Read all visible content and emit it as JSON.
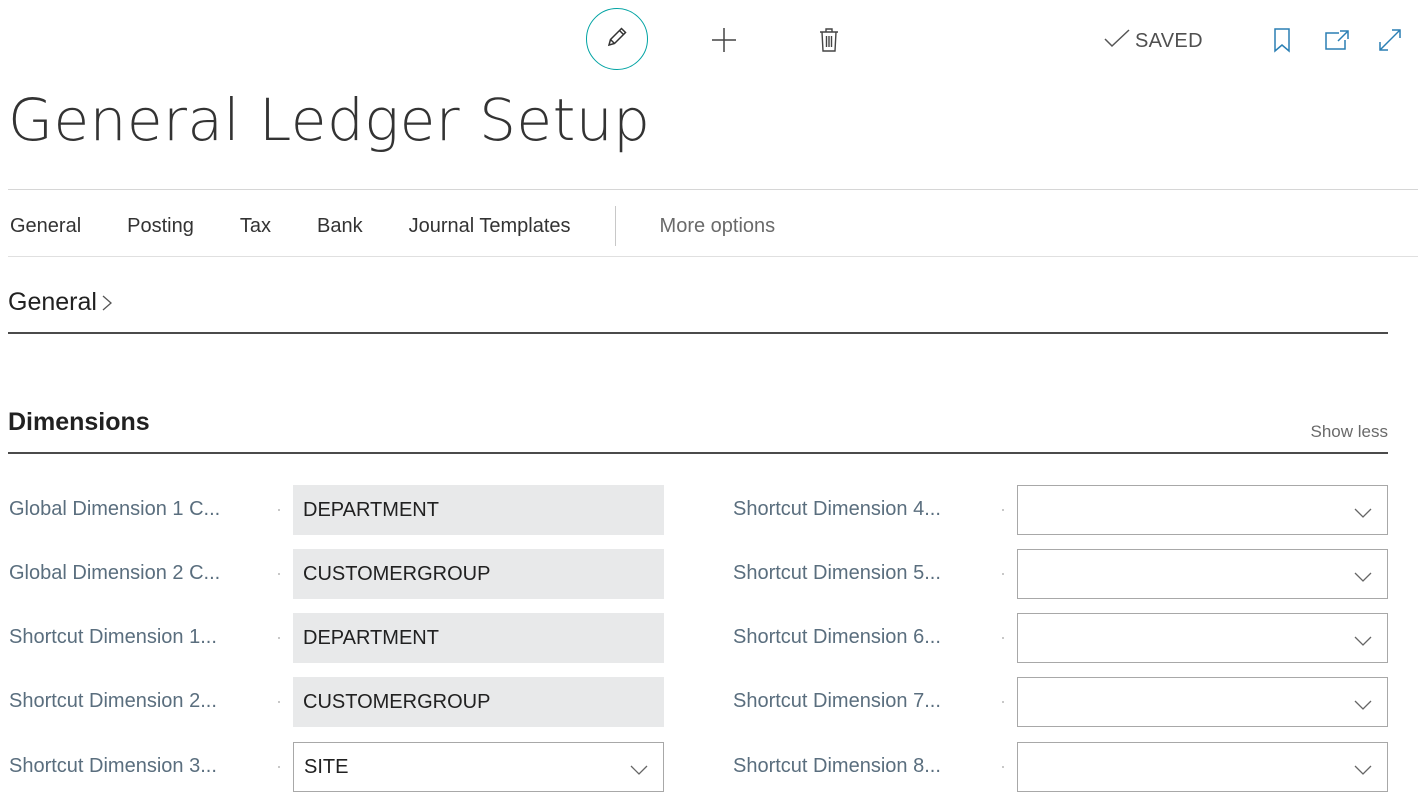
{
  "toolbar": {
    "edit_icon": "pencil-icon",
    "new_icon": "plus-icon",
    "delete_icon": "trash-icon",
    "status": "SAVED",
    "bookmark_icon": "bookmark-icon",
    "open_new_window_icon": "open-in-new-window-icon",
    "expand_icon": "expand-icon",
    "accent_color": "#00a3a3"
  },
  "page": {
    "title": "General Ledger Setup"
  },
  "tabs": [
    "General",
    "Posting",
    "Tax",
    "Bank",
    "Journal Templates"
  ],
  "more_options": "More options",
  "sections": {
    "general": "General",
    "dimensions": "Dimensions",
    "show_less": "Show less"
  },
  "fields_left": [
    {
      "label": "Global Dimension 1 C...",
      "value": "DEPARTMENT",
      "type": "readonly"
    },
    {
      "label": "Global Dimension 2 C...",
      "value": "CUSTOMERGROUP",
      "type": "readonly"
    },
    {
      "label": "Shortcut Dimension 1...",
      "value": "DEPARTMENT",
      "type": "readonly"
    },
    {
      "label": "Shortcut Dimension 2...",
      "value": "CUSTOMERGROUP",
      "type": "readonly"
    },
    {
      "label": "Shortcut Dimension 3...",
      "value": "SITE",
      "type": "dropdown"
    }
  ],
  "fields_right": [
    {
      "label": "Shortcut Dimension 4...",
      "value": "",
      "type": "dropdown"
    },
    {
      "label": "Shortcut Dimension 5...",
      "value": "",
      "type": "dropdown"
    },
    {
      "label": "Shortcut Dimension 6...",
      "value": "",
      "type": "dropdown"
    },
    {
      "label": "Shortcut Dimension 7...",
      "value": "",
      "type": "dropdown"
    },
    {
      "label": "Shortcut Dimension 8...",
      "value": "",
      "type": "dropdown"
    }
  ]
}
